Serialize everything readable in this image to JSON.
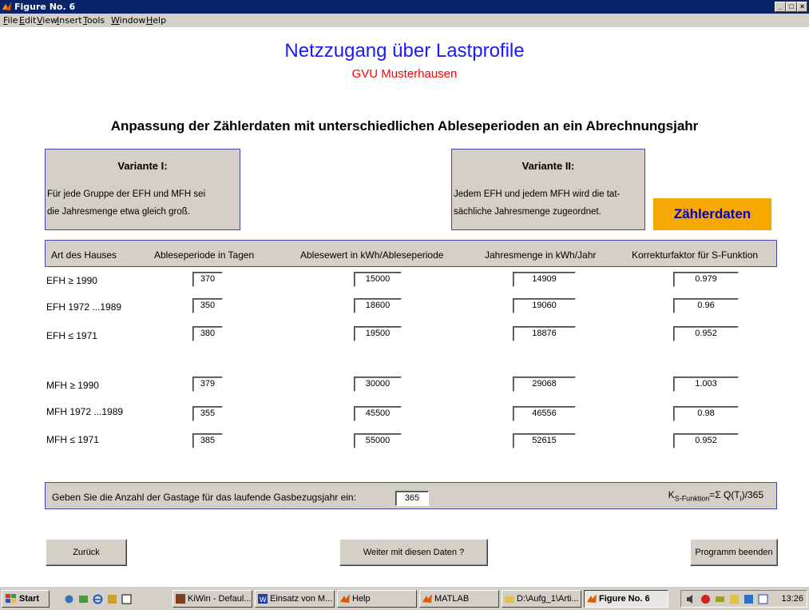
{
  "window": {
    "title": "Figure No. 6",
    "controls": [
      "_",
      "□",
      "×"
    ]
  },
  "menu": [
    "File",
    "Edit",
    "View",
    "Insert",
    "Tools",
    "Window",
    "Help"
  ],
  "figure": {
    "title": "Netzzugang über Lastprofile",
    "subtitle": "GVU Musterhausen",
    "heading": "Anpassung der Zählerdaten mit unterschiedlichen Ableseperioden an ein Abrechnungsjahr",
    "variant1": {
      "title": "Variante I:",
      "line1": "Für jede Gruppe der EFH und MFH sei",
      "line2": "die Jahresmenge etwa gleich groß."
    },
    "variant2": {
      "title": "Variante II:",
      "line1": "Jedem EFH und jedem MFH wird die tat-",
      "line2": "sächliche Jahresmenge zugeordnet."
    },
    "zaehlerdaten_button": "Zählerdaten",
    "columns": [
      "Art des Hauses",
      "Ableseperiode in Tagen",
      "Ablesewert in kWh/Ableseperiode",
      "Jahresmenge in kWh/Jahr",
      "Korrekturfaktor für S-Funktion"
    ],
    "rows": [
      {
        "label": "EFH ≥ 1990",
        "periode": "370",
        "ablesewert": "15000",
        "jahresmenge": "14909",
        "faktor": "0.979"
      },
      {
        "label": "EFH 1972 ...1989",
        "periode": "350",
        "ablesewert": "18600",
        "jahresmenge": "19060",
        "faktor": "0.96"
      },
      {
        "label": "EFH ≤ 1971",
        "periode": "380",
        "ablesewert": "19500",
        "jahresmenge": "18876",
        "faktor": "0.952"
      },
      {
        "label": "MFH ≥ 1990",
        "periode": "379",
        "ablesewert": "30000",
        "jahresmenge": "29068",
        "faktor": "1.003"
      },
      {
        "label": "MFH 1972 ...1989",
        "periode": "355",
        "ablesewert": "45500",
        "jahresmenge": "46556",
        "faktor": "0.98"
      },
      {
        "label": "MFH ≤ 1971",
        "periode": "385",
        "ablesewert": "55000",
        "jahresmenge": "52615",
        "faktor": "0.952"
      }
    ],
    "gastage_prompt": "Geben Sie die Anzahl der Gastage für das laufende Gasbezugsjahr ein:",
    "gastage_value": "365",
    "formula": {
      "k": "K",
      "k_sub": "S-Funktion",
      "eq": "=Σ Q(T",
      "t_sub": "i",
      "end": ")/365"
    },
    "buttons": {
      "back": "Zurück",
      "continue": "Weiter mit diesen Daten ?",
      "quit": "Programm beenden"
    }
  },
  "taskbar": {
    "start": "Start",
    "tasks": [
      "KiWin - Defaul...",
      "Einsatz von M...",
      "Help",
      "MATLAB",
      "D:\\Aufg_1\\Arti...",
      "Figure No. 6"
    ],
    "clock": "13:26"
  },
  "colors": {
    "title_blue": "#1a1aff",
    "subtitle_red": "#ff0000",
    "button_orange": "#f5a800",
    "panel_gray": "#d4d0c8",
    "titlebar_navy": "#0a246a"
  }
}
